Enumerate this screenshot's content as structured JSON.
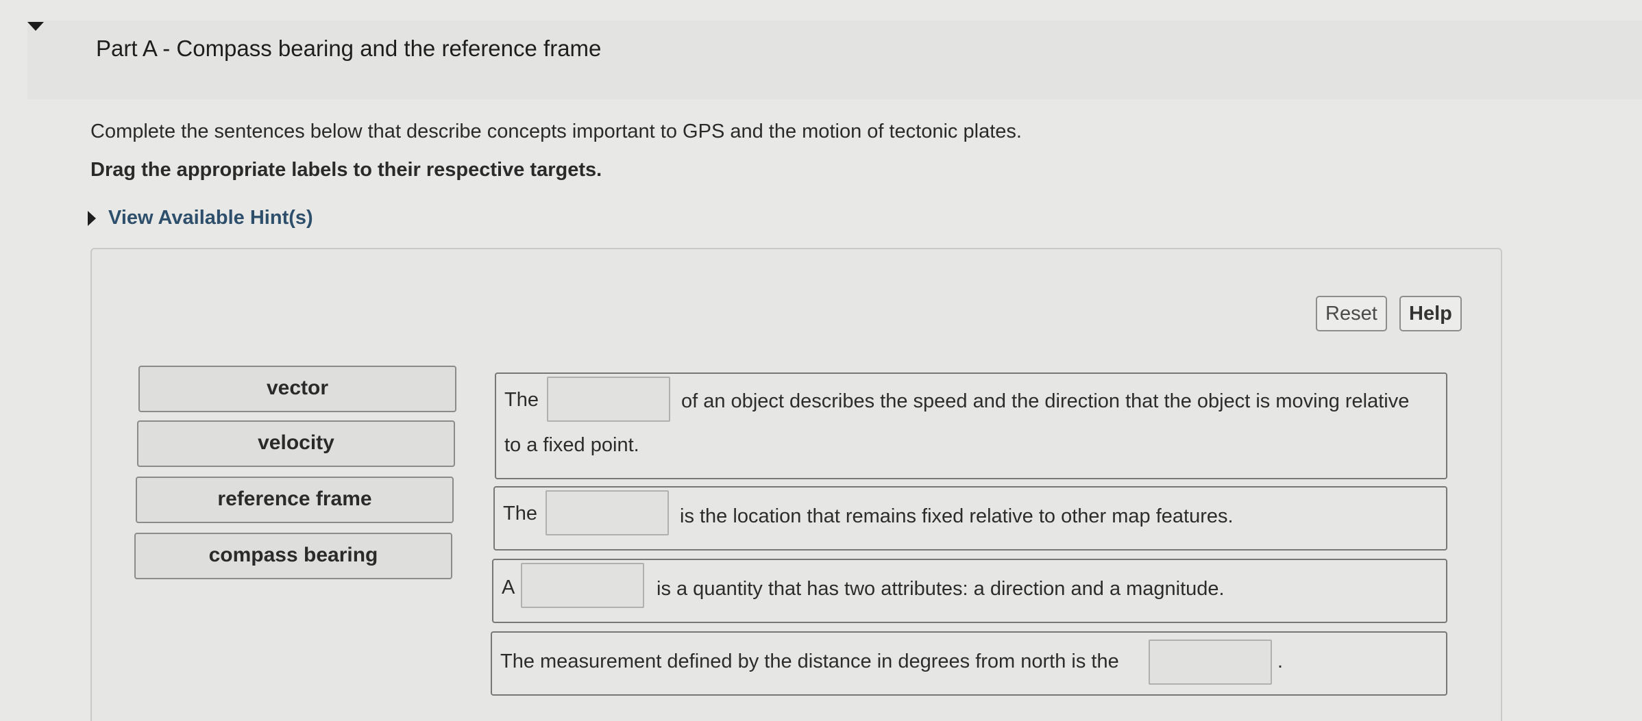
{
  "part": {
    "title": "Part A - Compass bearing and the reference frame"
  },
  "instructions": {
    "text": "Complete the sentences below that describe concepts important to GPS and the motion of tectonic plates.",
    "bold": "Drag the appropriate labels to their respective targets."
  },
  "hint": {
    "label": "View Available Hint(s)"
  },
  "toolbar": {
    "reset": "Reset",
    "help": "Help"
  },
  "labels": [
    "vector",
    "velocity",
    "reference frame",
    "compass bearing"
  ],
  "sentences": {
    "s1": {
      "before": "The",
      "after": "of an object describes the speed and the direction that the object is moving relative",
      "line2": "to a fixed point."
    },
    "s2": {
      "before": "The",
      "after": "is the location that remains fixed relative to other map features."
    },
    "s3": {
      "before": "A",
      "after": "is a quantity that has two attributes: a direction and a magnitude."
    },
    "s4": {
      "before": "The measurement defined by the distance in degrees from north is the",
      "after": "."
    }
  }
}
